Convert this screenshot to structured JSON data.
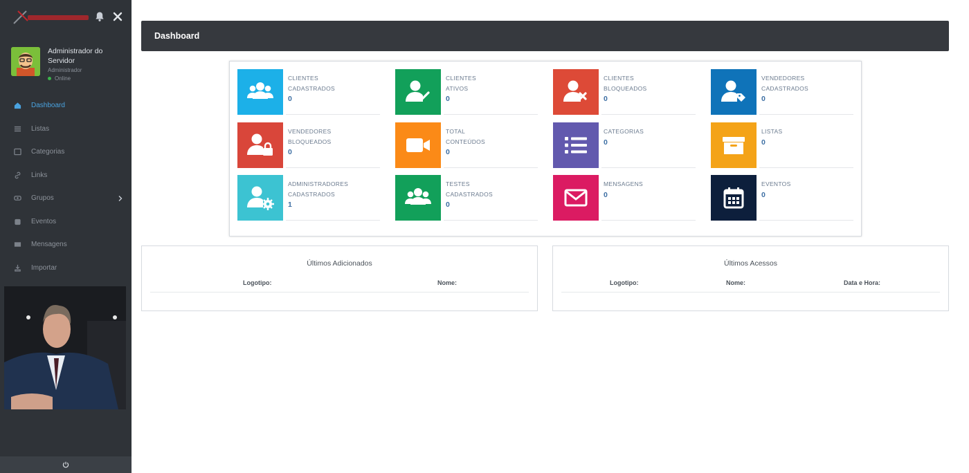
{
  "sidebar": {
    "user": {
      "name": "Administrador do Servidor",
      "role": "Administrador",
      "status": "Online"
    },
    "menu": [
      {
        "label": "Dashboard",
        "icon": "home-icon",
        "active": true
      },
      {
        "label": "Listas",
        "icon": "list-icon"
      },
      {
        "label": "Categorias",
        "icon": "folder-icon"
      },
      {
        "label": "Links",
        "icon": "link-icon"
      },
      {
        "label": "Grupos",
        "icon": "group-icon"
      },
      {
        "label": "Eventos",
        "icon": "calendar-icon"
      },
      {
        "label": "Mensagens",
        "icon": "mail-icon"
      },
      {
        "label": "Importar",
        "icon": "import-icon"
      }
    ]
  },
  "header": {
    "title": "Dashboard"
  },
  "tiles": [
    {
      "line1": "CLIENTES",
      "line2": "CADASTRADOS",
      "value": "0",
      "color": "#1cb0e8",
      "icon": "users-icon"
    },
    {
      "line1": "CLIENTES",
      "line2": "ATIVOS",
      "value": "0",
      "color": "#12a05a",
      "icon": "user-check-icon"
    },
    {
      "line1": "CLIENTES",
      "line2": "BLOQUEADOS",
      "value": "0",
      "color": "#dd4a37",
      "icon": "user-times-icon"
    },
    {
      "line1": "VENDEDORES",
      "line2": "CADASTRADOS",
      "value": "0",
      "color": "#0f73b9",
      "icon": "user-tag-icon"
    },
    {
      "line1": "VENDEDORES",
      "line2": "BLOQUEADOS",
      "value": "0",
      "color": "#d9463a",
      "icon": "user-lock-icon"
    },
    {
      "line1": "TOTAL",
      "line2": "CONTEÚDOS",
      "value": "0",
      "color": "#fb8a17",
      "icon": "video-icon"
    },
    {
      "line1": "CATEGORIAS",
      "line2": "",
      "value": "0",
      "color": "#6259ae",
      "icon": "list-icon"
    },
    {
      "line1": "LISTAS",
      "line2": "",
      "value": "0",
      "color": "#f4a318",
      "icon": "archive-icon"
    },
    {
      "line1": "ADMINISTRADORES",
      "line2": "CADASTRADOS",
      "value": "1",
      "color": "#3cc3d2",
      "icon": "user-cog-icon"
    },
    {
      "line1": "TESTES",
      "line2": "CADASTRADOS",
      "value": "0",
      "color": "#12a05a",
      "icon": "users-icon"
    },
    {
      "line1": "MENSAGENS",
      "line2": "",
      "value": "0",
      "color": "#db1b62",
      "icon": "envelope-icon"
    },
    {
      "line1": "EVENTOS",
      "line2": "",
      "value": "0",
      "color": "#0d1f3c",
      "icon": "calendar-icon"
    }
  ],
  "latest_added": {
    "title": "Últimos Adicionados",
    "columns": [
      "Logotipo:",
      "Nome:"
    ]
  },
  "latest_access": {
    "title": "Últimos Acessos",
    "columns": [
      "Logotipo:",
      "Nome:",
      "Data e Hora:"
    ]
  }
}
